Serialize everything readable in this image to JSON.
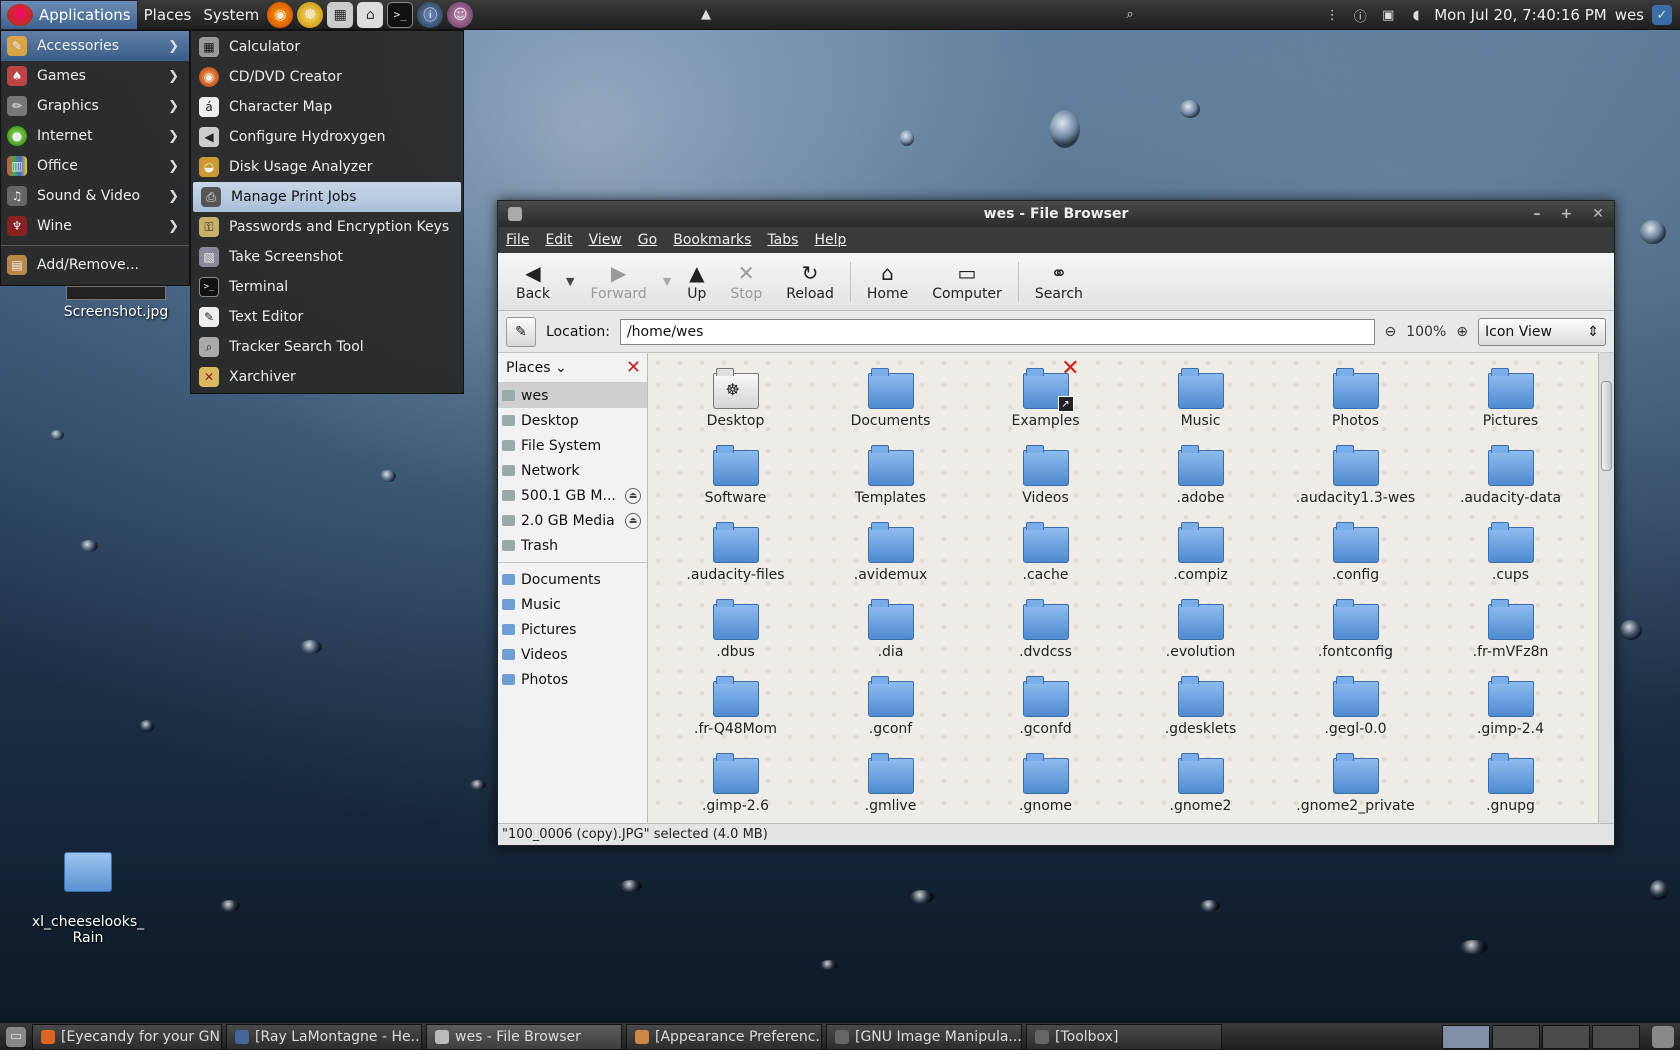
{
  "top_panel": {
    "menus": [
      "Applications",
      "Places",
      "System"
    ],
    "clock": "Mon Jul 20,  7:40:16 PM",
    "user": "wes"
  },
  "app_menu": {
    "items": [
      {
        "label": "Accessories",
        "icon": "accessories-icon"
      },
      {
        "label": "Games",
        "icon": "games-icon"
      },
      {
        "label": "Graphics",
        "icon": "graphics-icon"
      },
      {
        "label": "Internet",
        "icon": "internet-icon"
      },
      {
        "label": "Office",
        "icon": "office-icon"
      },
      {
        "label": "Sound & Video",
        "icon": "sound-video-icon"
      },
      {
        "label": "Wine",
        "icon": "wine-icon"
      }
    ],
    "add_remove": "Add/Remove..."
  },
  "accessories_menu": {
    "items": [
      "Calculator",
      "CD/DVD Creator",
      "Character Map",
      "Configure Hydroxygen",
      "Disk Usage Analyzer",
      "Manage Print Jobs",
      "Passwords and Encryption Keys",
      "Take Screenshot",
      "Terminal",
      "Text Editor",
      "Tracker Search Tool",
      "Xarchiver"
    ]
  },
  "desktop": {
    "icons": [
      {
        "label": "Screenshot.jpg"
      },
      {
        "label": "xl_cheeselooks_\nRain"
      }
    ]
  },
  "file_browser": {
    "title": "wes - File Browser",
    "menubar": [
      "File",
      "Edit",
      "View",
      "Go",
      "Bookmarks",
      "Tabs",
      "Help"
    ],
    "toolbar": {
      "back": "Back",
      "forward": "Forward",
      "up": "Up",
      "stop": "Stop",
      "reload": "Reload",
      "home": "Home",
      "computer": "Computer",
      "search": "Search"
    },
    "location_label": "Location:",
    "location_value": "/home/wes",
    "zoom": "100%",
    "view_mode": "Icon View",
    "sidebar": {
      "header": "Places",
      "places": [
        {
          "label": "wes"
        },
        {
          "label": "Desktop"
        },
        {
          "label": "File System"
        },
        {
          "label": "Network"
        },
        {
          "label": "500.1 GB M..."
        },
        {
          "label": "2.0 GB Media"
        },
        {
          "label": "Trash"
        }
      ],
      "bookmarks": [
        "Documents",
        "Music",
        "Pictures",
        "Videos",
        "Photos"
      ]
    },
    "files": [
      "Desktop",
      "Documents",
      "Examples",
      "Music",
      "Photos",
      "Pictures",
      "Software",
      "Templates",
      "Videos",
      ".adobe",
      ".audacity1.3-wes",
      ".audacity-data",
      ".audacity-files",
      ".avidemux",
      ".cache",
      ".compiz",
      ".config",
      ".cups",
      ".dbus",
      ".dia",
      ".dvdcss",
      ".evolution",
      ".fontconfig",
      ".fr-mVFz8n",
      ".fr-Q48Mom",
      ".gconf",
      ".gconfd",
      ".gdesklets",
      ".gegl-0.0",
      ".gimp-2.4",
      ".gimp-2.6",
      ".gmlive",
      ".gnome",
      ".gnome2",
      ".gnome2_private",
      ".gnupg"
    ],
    "status": "\"100_0006 (copy).JPG\" selected (4.0 MB)"
  },
  "taskbar": {
    "tasks": [
      "[Eyecandy for your GN...",
      "[Ray LaMontagne - He...",
      "wes - File Browser",
      "[Appearance Preferenc...",
      "[GNU Image Manipula...",
      "[Toolbox]"
    ]
  }
}
